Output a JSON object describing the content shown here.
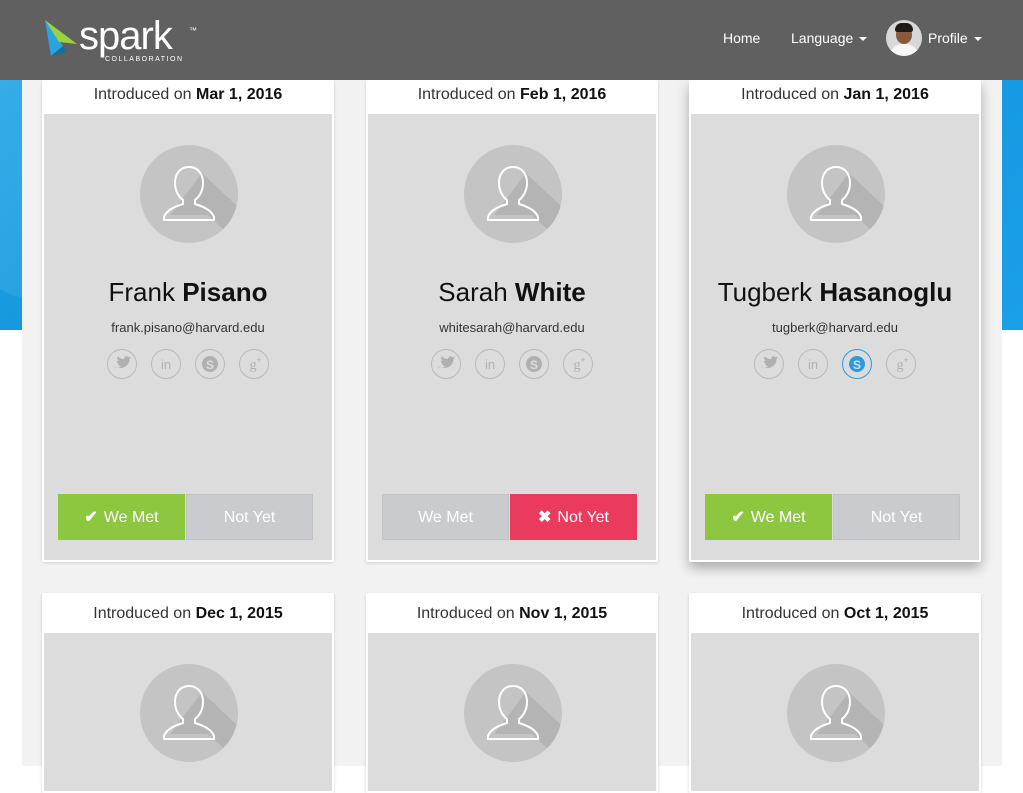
{
  "brand": {
    "logo_text": "spark",
    "trademark": "™",
    "sub": "COLLABORATION"
  },
  "nav": {
    "home": "Home",
    "language": "Language",
    "profile": "Profile"
  },
  "intro_prefix": "Introduced on",
  "buttons": {
    "met": "We Met",
    "not_yet": "Not Yet"
  },
  "cards": [
    {
      "date": "Mar 1, 2016",
      "first": "Frank",
      "last": "Pisano",
      "email": "frank.pisano@harvard.edu",
      "status": "met"
    },
    {
      "date": "Feb 1, 2016",
      "first": "Sarah",
      "last": "White",
      "email": "whitesarah@harvard.edu",
      "status": "not_yet"
    },
    {
      "date": "Jan 1, 2016",
      "first": "Tugberk",
      "last": "Hasanoglu",
      "email": "tugberk@harvard.edu",
      "status": "met"
    },
    {
      "date": "Dec 1, 2015"
    },
    {
      "date": "Nov 1, 2015"
    },
    {
      "date": "Oct 1, 2015"
    }
  ],
  "social_icons": [
    "twitter-icon",
    "linkedin-icon",
    "skype-icon",
    "google-plus-icon"
  ],
  "colors": {
    "navbar": "#606060",
    "met_green": "#8dc63f",
    "not_yet_red": "#ea3a5e",
    "skype_active": "#2b9be0",
    "background_blue": "#1aa0e6"
  }
}
